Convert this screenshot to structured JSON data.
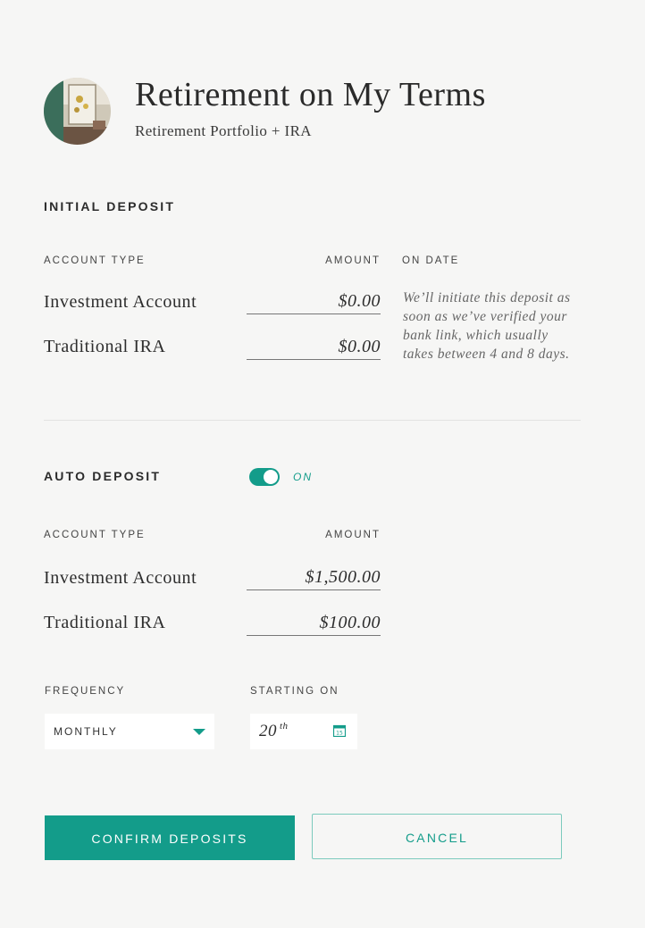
{
  "header": {
    "title": "Retirement on My Terms",
    "subtitle": "Retirement Portfolio + IRA"
  },
  "initial_deposit": {
    "heading": "INITIAL DEPOSIT",
    "col_account": "ACCOUNT TYPE",
    "col_amount": "AMOUNT",
    "col_date": "ON DATE",
    "rows": [
      {
        "label": "Investment Account",
        "amount": "$0.00"
      },
      {
        "label": "Traditional IRA",
        "amount": "$0.00"
      }
    ],
    "note": "We’ll initiate this deposit as soon as we’ve verified your bank link, which usually takes between 4 and 8 days."
  },
  "auto_deposit": {
    "heading": "AUTO DEPOSIT",
    "toggle_state": "ON",
    "col_account": "ACCOUNT TYPE",
    "col_amount": "AMOUNT",
    "rows": [
      {
        "label": "Investment Account",
        "amount": "$1,500.00"
      },
      {
        "label": "Traditional IRA",
        "amount": "$100.00"
      }
    ],
    "frequency_label": "FREQUENCY",
    "frequency_value": "MONTHLY",
    "starting_label": "STARTING ON",
    "starting_day": "20",
    "starting_suffix": "th",
    "calendar_day": "15"
  },
  "actions": {
    "confirm": "CONFIRM DEPOSITS",
    "cancel": "CANCEL"
  },
  "colors": {
    "accent": "#139c8a",
    "background": "#f6f6f5"
  },
  "icons": {
    "avatar": "avatar-photo",
    "dropdown": "chevron-down-icon",
    "calendar": "calendar-icon"
  }
}
